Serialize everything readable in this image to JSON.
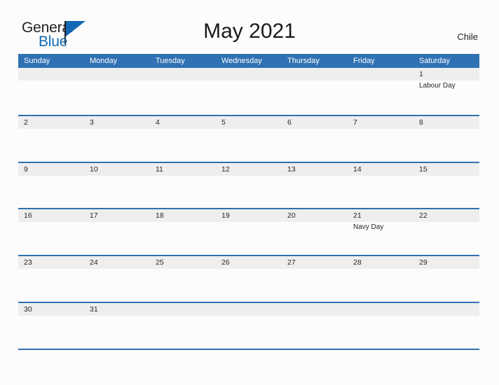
{
  "header": {
    "logo": {
      "word_one": "General",
      "word_two": "Blue",
      "flag_icon": "blue-triangle-flag-icon",
      "color_dark": "#231f20",
      "color_blue": "#1268b3"
    },
    "title": "May 2021",
    "country": "Chile"
  },
  "calendar": {
    "accent_color": "#2f71b3",
    "band_color": "#eeeeee",
    "weekdays": [
      "Sunday",
      "Monday",
      "Tuesday",
      "Wednesday",
      "Thursday",
      "Friday",
      "Saturday"
    ],
    "weeks": [
      [
        {
          "date": "",
          "events": []
        },
        {
          "date": "",
          "events": []
        },
        {
          "date": "",
          "events": []
        },
        {
          "date": "",
          "events": []
        },
        {
          "date": "",
          "events": []
        },
        {
          "date": "",
          "events": []
        },
        {
          "date": "1",
          "events": [
            "Labour Day"
          ]
        }
      ],
      [
        {
          "date": "2",
          "events": []
        },
        {
          "date": "3",
          "events": []
        },
        {
          "date": "4",
          "events": []
        },
        {
          "date": "5",
          "events": []
        },
        {
          "date": "6",
          "events": []
        },
        {
          "date": "7",
          "events": []
        },
        {
          "date": "8",
          "events": []
        }
      ],
      [
        {
          "date": "9",
          "events": []
        },
        {
          "date": "10",
          "events": []
        },
        {
          "date": "11",
          "events": []
        },
        {
          "date": "12",
          "events": []
        },
        {
          "date": "13",
          "events": []
        },
        {
          "date": "14",
          "events": []
        },
        {
          "date": "15",
          "events": []
        }
      ],
      [
        {
          "date": "16",
          "events": []
        },
        {
          "date": "17",
          "events": []
        },
        {
          "date": "18",
          "events": []
        },
        {
          "date": "19",
          "events": []
        },
        {
          "date": "20",
          "events": []
        },
        {
          "date": "21",
          "events": [
            "Navy Day"
          ]
        },
        {
          "date": "22",
          "events": []
        }
      ],
      [
        {
          "date": "23",
          "events": []
        },
        {
          "date": "24",
          "events": []
        },
        {
          "date": "25",
          "events": []
        },
        {
          "date": "26",
          "events": []
        },
        {
          "date": "27",
          "events": []
        },
        {
          "date": "28",
          "events": []
        },
        {
          "date": "29",
          "events": []
        }
      ],
      [
        {
          "date": "30",
          "events": []
        },
        {
          "date": "31",
          "events": []
        },
        {
          "date": "",
          "events": []
        },
        {
          "date": "",
          "events": []
        },
        {
          "date": "",
          "events": []
        },
        {
          "date": "",
          "events": []
        },
        {
          "date": "",
          "events": []
        }
      ]
    ]
  }
}
